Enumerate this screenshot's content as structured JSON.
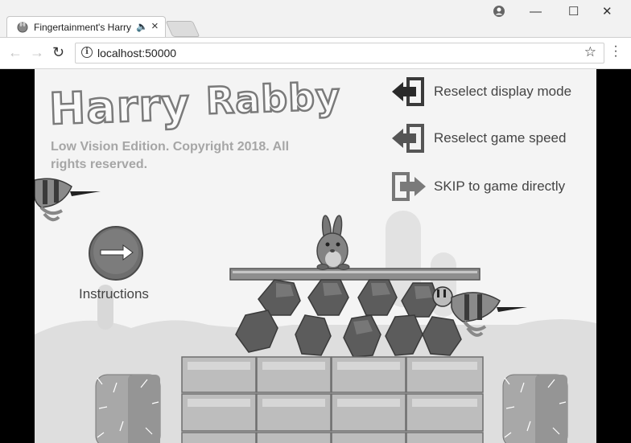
{
  "browser": {
    "tab_title": "Fingertainment's Harry Rabby",
    "address": "localhost:50000",
    "controls": {
      "minimize": "—",
      "maximize": "☐",
      "close": "✕"
    }
  },
  "game": {
    "logo_word1": "Harry",
    "logo_word2": "Rabby",
    "copyright": "Low Vision Edition. Copyright 2018. All rights reserved.",
    "menu": {
      "reselect_display": "Reselect display mode",
      "reselect_speed": "Reselect game speed",
      "skip": "SKIP to game directly"
    },
    "instructions_label": "Instructions"
  },
  "icons": [
    "back-arrow-icon",
    "forward-arrow-icon",
    "reload-icon",
    "info-icon",
    "star-icon",
    "menu-icon",
    "user-icon",
    "exit-door-icon",
    "enter-door-icon",
    "arrow-right-icon"
  ],
  "colors": {
    "chrome_bg": "#f2f2f2",
    "stage_bg": "#f4f4f4",
    "letterbox": "#000000",
    "text": "#444444"
  }
}
